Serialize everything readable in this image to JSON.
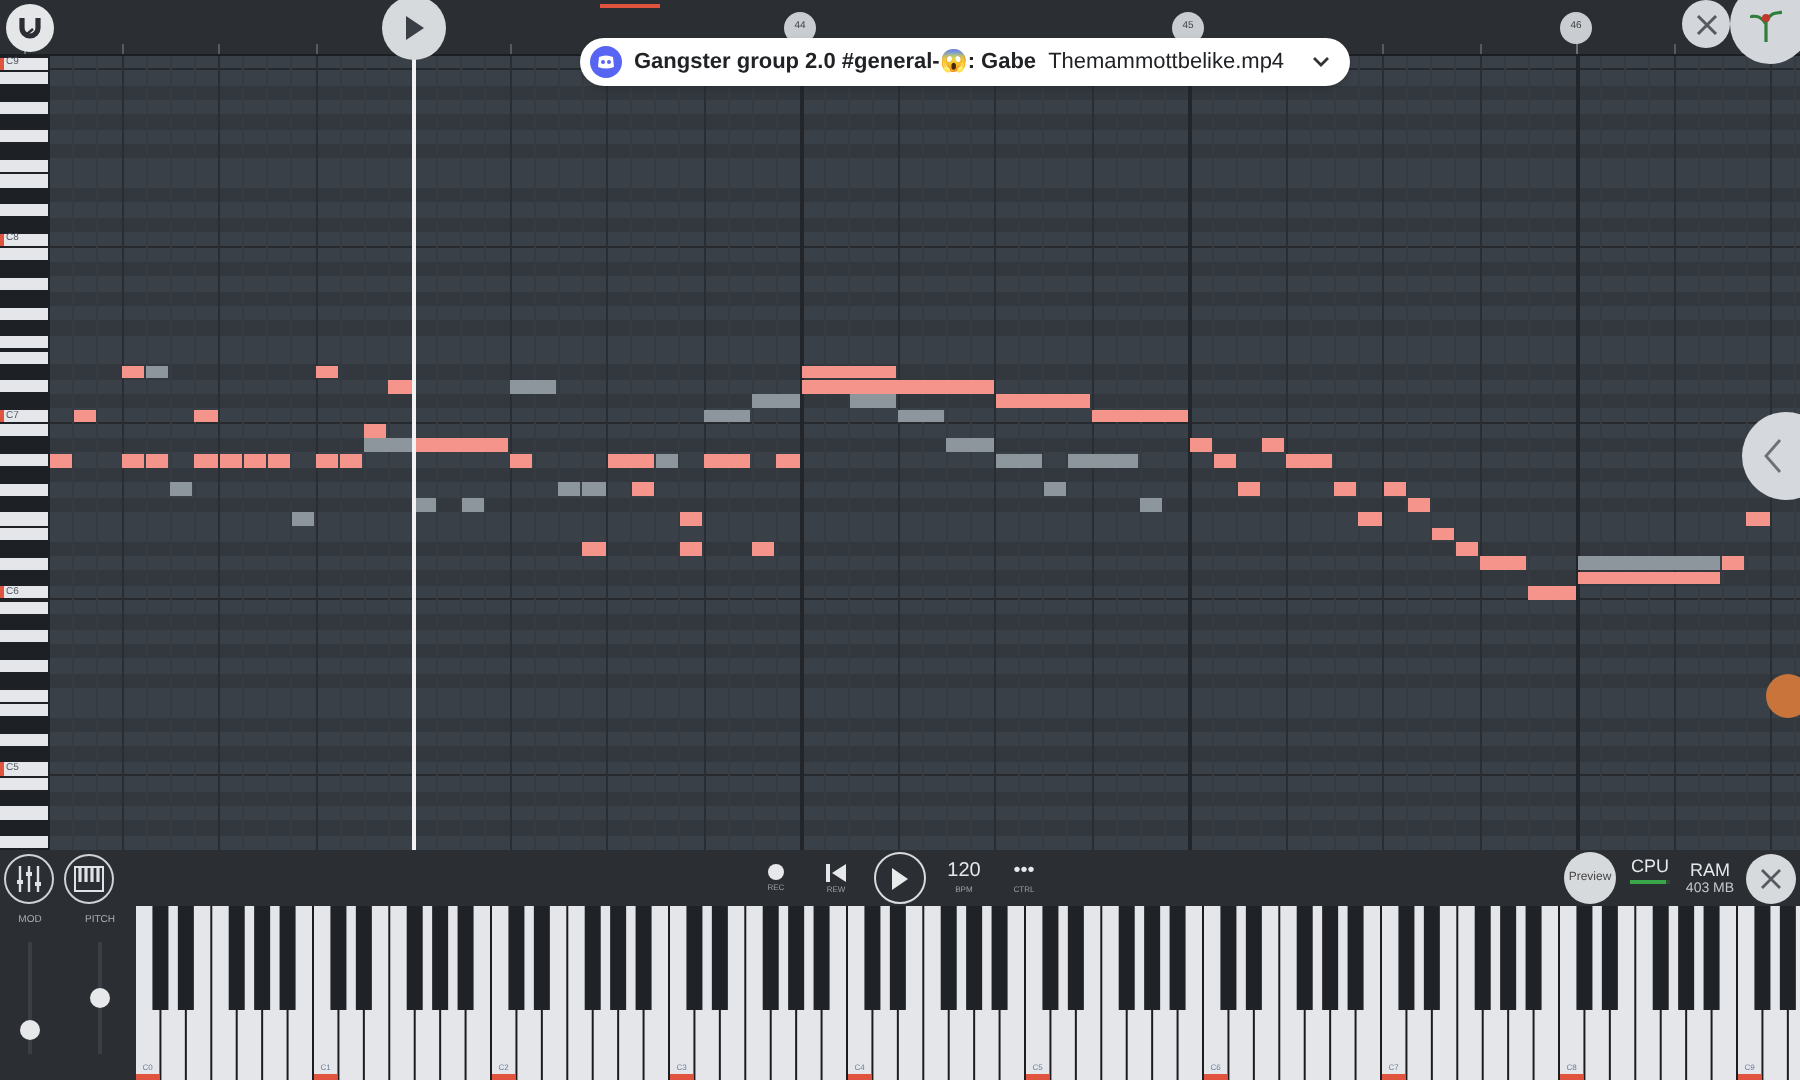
{
  "timeline": {
    "bar_markers": [
      "44",
      "45",
      "46"
    ]
  },
  "notification": {
    "title": "Gangster group 2.0 #general-😱: Gabe",
    "subtitle": "Themammottbelike.mp4"
  },
  "roll_keyboard": {
    "labels": [
      "C9",
      "C8",
      "C7",
      "C6",
      "C5"
    ]
  },
  "transport": [
    {
      "kind": "record",
      "label": "REC"
    },
    {
      "kind": "rewind",
      "label": "REW"
    },
    {
      "kind": "play"
    },
    {
      "kind": "tempo",
      "value": "120",
      "label": "BPM"
    },
    {
      "kind": "more",
      "value": "•••",
      "label": "CTRL"
    }
  ],
  "right_tools": {
    "preview": "Preview",
    "cpu": {
      "label": "CPU",
      "level": 0.9
    },
    "ram": {
      "label": "RAM",
      "value": "403 MB"
    }
  },
  "controllers": [
    {
      "label": "MOD",
      "level": 0.15
    },
    {
      "label": "PITCH",
      "level": 0.5
    }
  ],
  "keyboard": {
    "labels": [
      "C0",
      "C1",
      "C2",
      "C3",
      "C4",
      "C5",
      "C6",
      "C7",
      "C8",
      "C9"
    ]
  }
}
